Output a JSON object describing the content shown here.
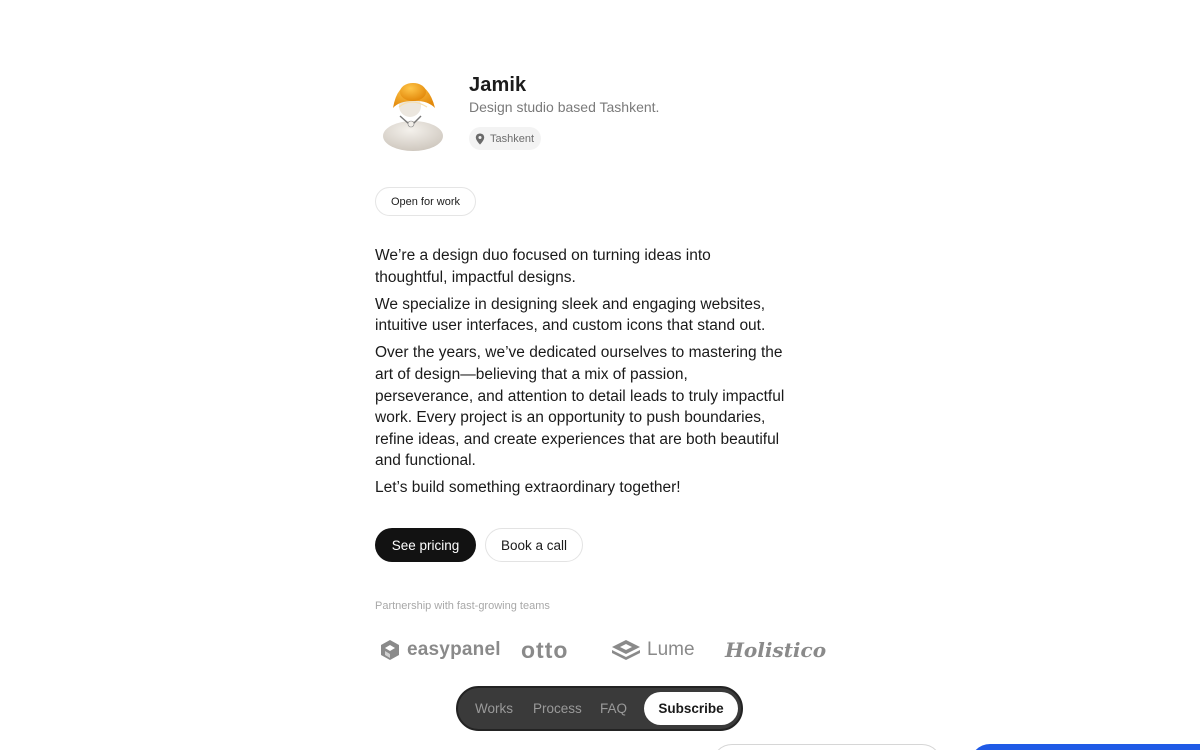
{
  "profile": {
    "name": "Jamik",
    "tagline": "Design studio based Tashkent.",
    "location": "Tashkent",
    "status": "Open for work"
  },
  "bio": [
    "We’re a design duo focused on turning ideas into thoughtful, impactful designs.",
    "We specialize in designing sleek and engaging websites, intuitive user interfaces, and custom icons that stand out.",
    "Over the years, we’ve dedicated ourselves to mastering the art of design—believing that a mix of passion, perseverance, and attention to detail leads to truly impactful work. Every project is an opportunity to push boundaries, refine ideas, and create experiences that are both beautiful and functional.",
    "Let’s build something extraordinary together!"
  ],
  "cta": {
    "primary": "See pricing",
    "secondary": "Book a call"
  },
  "partners": {
    "label": "Partnership with fast-growing teams",
    "logos": [
      "easypanel",
      "otto",
      "Lume",
      "Holistico"
    ]
  },
  "nav": {
    "works": "Works",
    "process": "Process",
    "faq": "FAQ",
    "subscribe": "Subscribe"
  },
  "colors": {
    "primary_button": "#121212",
    "nav_background": "#3a3a3a",
    "accent_blue": "#1f5ae6"
  },
  "icons": {
    "avatar": "avatar-figure-with-yellow-hat",
    "location": "map-pin-icon"
  }
}
